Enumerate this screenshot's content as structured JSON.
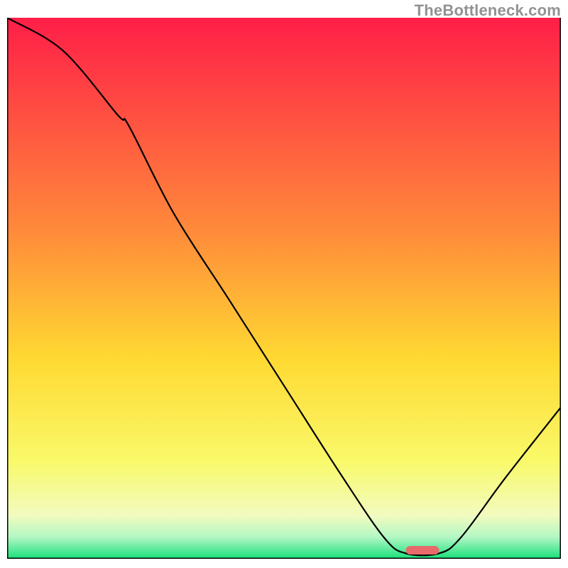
{
  "watermark": "TheBottleneck.com",
  "chart_data": {
    "type": "line",
    "title": "",
    "xlabel": "",
    "ylabel": "",
    "xlim": [
      0,
      100
    ],
    "ylim": [
      0,
      100
    ],
    "plot_background": {
      "type": "vertical_gradient",
      "stops": [
        {
          "offset": 0.0,
          "color": "#ff1e48"
        },
        {
          "offset": 0.4,
          "color": "#ff8c3a"
        },
        {
          "offset": 0.63,
          "color": "#ffd932"
        },
        {
          "offset": 0.82,
          "color": "#f9f96a"
        },
        {
          "offset": 0.92,
          "color": "#f2fbbf"
        },
        {
          "offset": 0.96,
          "color": "#b3f7c4"
        },
        {
          "offset": 1.0,
          "color": "#18e07a"
        }
      ]
    },
    "series": [
      {
        "name": "bottleneck-curve",
        "color": "#000000",
        "x": [
          0,
          10,
          20,
          22,
          30,
          40,
          50,
          60,
          68,
          72,
          78,
          82,
          90,
          100
        ],
        "y": [
          100,
          94,
          82,
          80,
          64,
          48,
          32,
          16,
          4,
          1,
          1,
          4,
          15,
          28
        ]
      }
    ],
    "marker": {
      "name": "target-zone",
      "shape": "rounded-rect",
      "x_center": 75,
      "width_pct": 6,
      "color": "#e96a6a"
    },
    "axes": {
      "border_color": "#000000",
      "show_ticks": false,
      "show_grid": false
    }
  }
}
